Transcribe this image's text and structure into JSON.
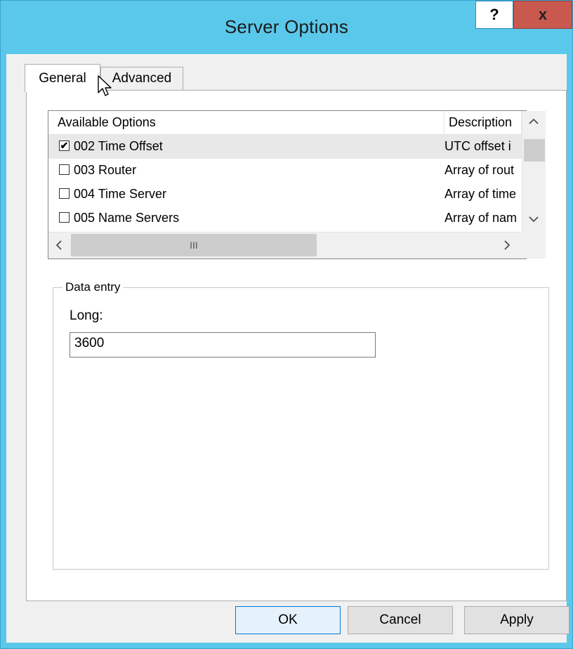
{
  "window": {
    "title": "Server Options"
  },
  "titlebar": {
    "help_label": "?",
    "close_label": "x"
  },
  "tabs": [
    {
      "label": "General"
    },
    {
      "label": "Advanced"
    }
  ],
  "options_list": {
    "columns": [
      "Available Options",
      "Description"
    ],
    "rows": [
      {
        "checked": true,
        "check_glyph": "✔",
        "name": "002 Time Offset",
        "description": "UTC offset i"
      },
      {
        "checked": false,
        "check_glyph": "",
        "name": "003 Router",
        "description": "Array of rout"
      },
      {
        "checked": false,
        "check_glyph": "",
        "name": "004 Time Server",
        "description": "Array of time"
      },
      {
        "checked": false,
        "check_glyph": "",
        "name": "005 Name Servers",
        "description": "Array of nam"
      }
    ],
    "hscroll_thumb_glyph": "III"
  },
  "data_entry": {
    "group_label": "Data entry",
    "field_label": "Long:",
    "value": "3600"
  },
  "buttons": {
    "ok": "OK",
    "cancel": "Cancel",
    "apply": "Apply"
  },
  "icons": {
    "scroll_up": "chevron-up-icon",
    "scroll_down": "chevron-down-icon",
    "scroll_left": "chevron-left-icon",
    "scroll_right": "chevron-right-icon",
    "cursor": "mouse-pointer-icon"
  },
  "colors": {
    "titlebar": "#5ac8ea",
    "close_button": "#c9594f",
    "selected_row": "#e8e8e8"
  }
}
